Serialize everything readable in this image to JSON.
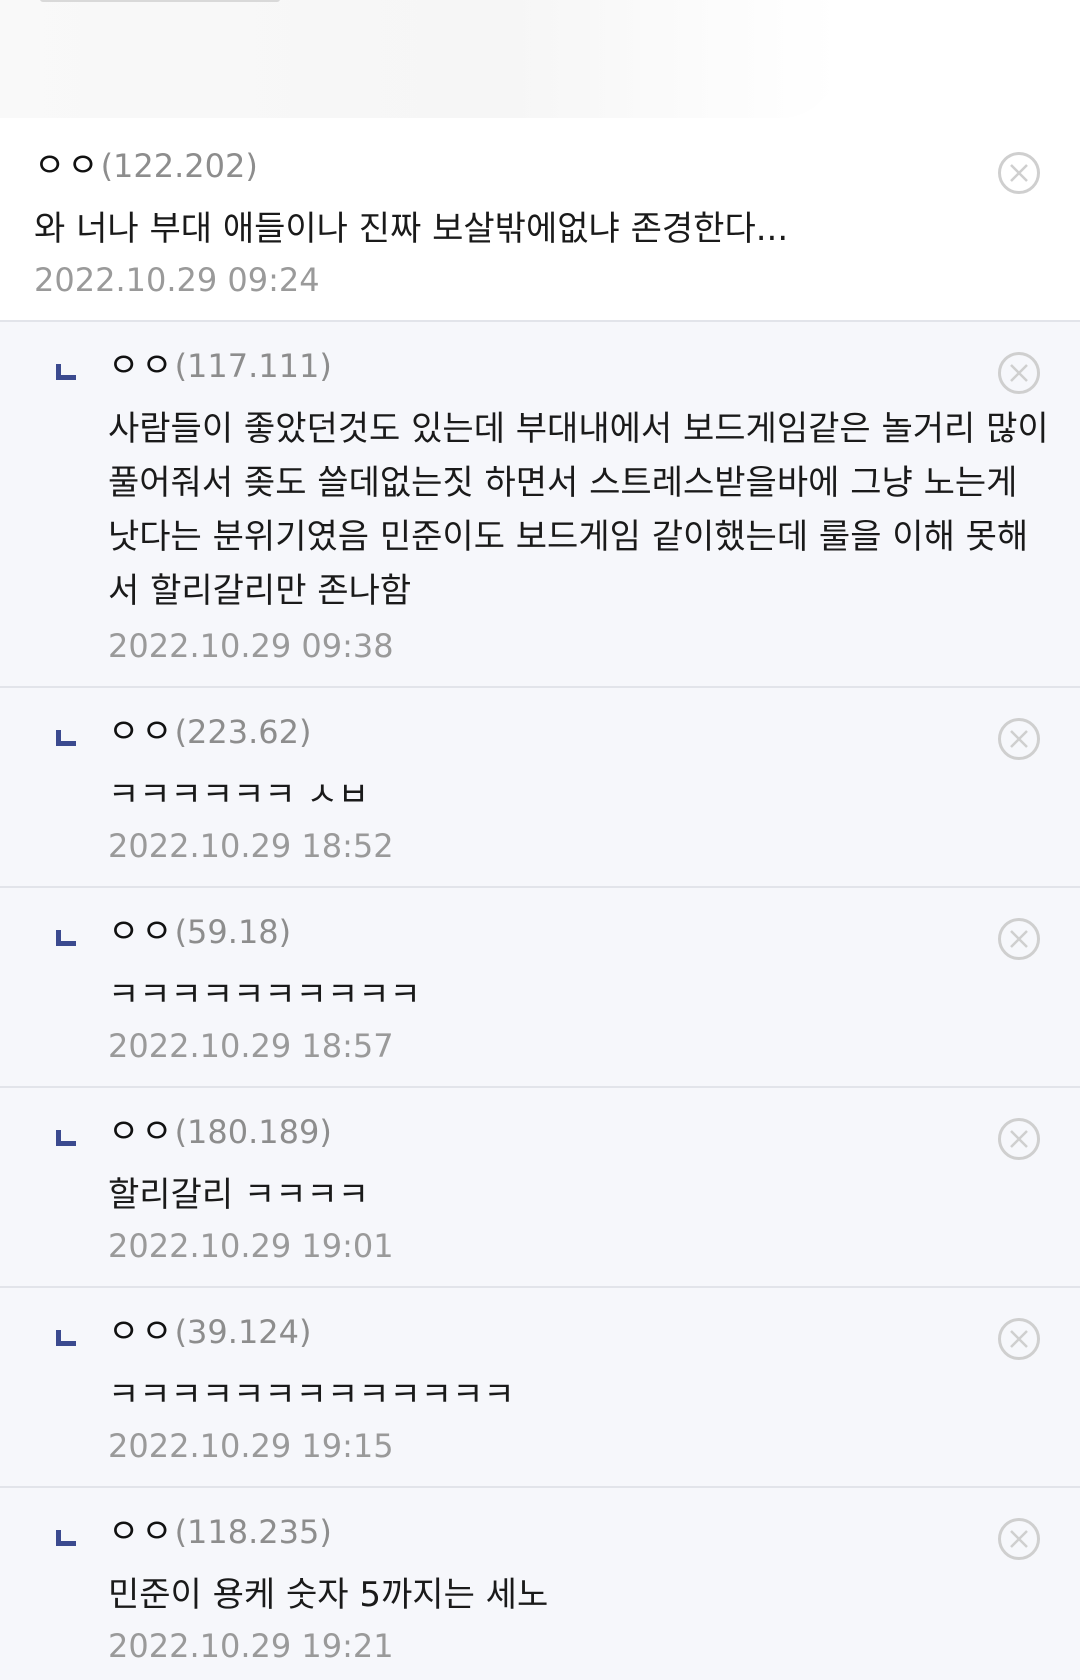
{
  "comments": [
    {
      "type": "root",
      "nick": "ㅇㅇ",
      "ip": "(122.202)",
      "lines": [
        "와 너나 부대 애들이나 진짜 보살밖에없냐 존경한다..."
      ],
      "date": "2022.10.29 09:24"
    },
    {
      "type": "reply",
      "nick": "ㅇㅇ",
      "ip": "(117.111)",
      "lines": [
        "사람들이 좋았던것도 있는데 부대내에서 보드게임같은 놀거리 많이",
        "풀어줘서 좆도 쓸데없는짓 하면서 스트레스받을바에 그냥 노는게",
        "낫다는 분위기였음 민준이도 보드게임 같이했는데 룰을 이해 못해",
        "서 할리갈리만 존나함"
      ],
      "date": "2022.10.29 09:38"
    },
    {
      "type": "reply",
      "nick": "ㅇㅇ",
      "ip": "(223.62)",
      "lines": [
        "ㅋㅋㅋㅋㅋㅋ ㅅㅂ"
      ],
      "date": "2022.10.29 18:52"
    },
    {
      "type": "reply",
      "nick": "ㅇㅇ",
      "ip": "(59.18)",
      "lines": [
        "ㅋㅋㅋㅋㅋㅋㅋㅋㅋㅋ"
      ],
      "date": "2022.10.29 18:57"
    },
    {
      "type": "reply",
      "nick": "ㅇㅇ",
      "ip": "(180.189)",
      "lines": [
        "할리갈리 ㅋㅋㅋㅋ"
      ],
      "date": "2022.10.29 19:01"
    },
    {
      "type": "reply",
      "nick": "ㅇㅇ",
      "ip": "(39.124)",
      "lines": [
        "ㅋㅋㅋㅋㅋㅋㅋㅋㅋㅋㅋㅋㅋ"
      ],
      "date": "2022.10.29 19:15"
    },
    {
      "type": "reply",
      "nick": "ㅇㅇ",
      "ip": "(118.235)",
      "lines": [
        "민준이 용케 숫자 5까지는 세노"
      ],
      "date": "2022.10.29 19:21"
    }
  ],
  "icons": {
    "reply": "reply-arrow-icon",
    "delete": "close-circle-icon"
  },
  "colors": {
    "reply_mark": "#3b4a8f",
    "reply_bg": "#f6f7fb",
    "ip_text": "#8d8d8d",
    "date_text": "#9a9a9a"
  }
}
